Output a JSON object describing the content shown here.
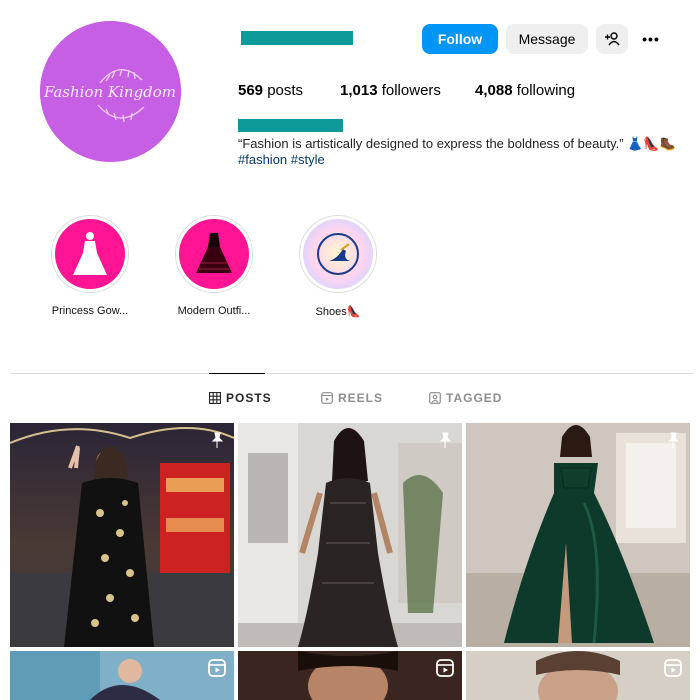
{
  "profile": {
    "avatar_text": "Fashion Kingdom",
    "follow_label": "Follow",
    "message_label": "Message",
    "add_user_icon": "+user",
    "more_icon": "•••"
  },
  "stats": {
    "posts_count": "569",
    "posts_label": "posts",
    "followers_count": "1,013",
    "followers_label": "followers",
    "following_count": "4,088",
    "following_label": "following"
  },
  "bio": {
    "quote": "“Fashion is artistically designed to express the boldness of beauty.” 👗👠🥾",
    "hashtags": "#fashion #style"
  },
  "highlights": [
    {
      "label": "Princess Gow...",
      "icon": "wedding-dress-icon"
    },
    {
      "label": "Modern Outfi...",
      "icon": "black-dress-icon"
    },
    {
      "label": "Shoes👠",
      "icon": "shoe-icon"
    }
  ],
  "tabs": {
    "posts": "POSTS",
    "reels": "REELS",
    "tagged": "TAGGED"
  },
  "grid": [
    {
      "type": "photo",
      "badge": "pin-icon"
    },
    {
      "type": "photo",
      "badge": "pin-icon"
    },
    {
      "type": "photo",
      "badge": "pin-icon"
    },
    {
      "type": "reel",
      "badge": "reel-icon"
    },
    {
      "type": "reel",
      "badge": "reel-icon"
    },
    {
      "type": "reel",
      "badge": "reel-icon"
    }
  ],
  "colors": {
    "accent": "#0095f6",
    "avatar_bg": "#c75fe4",
    "redaction": "#0f9a9a",
    "highlight_pink": "#ff1493",
    "hashtag": "#00376b"
  }
}
